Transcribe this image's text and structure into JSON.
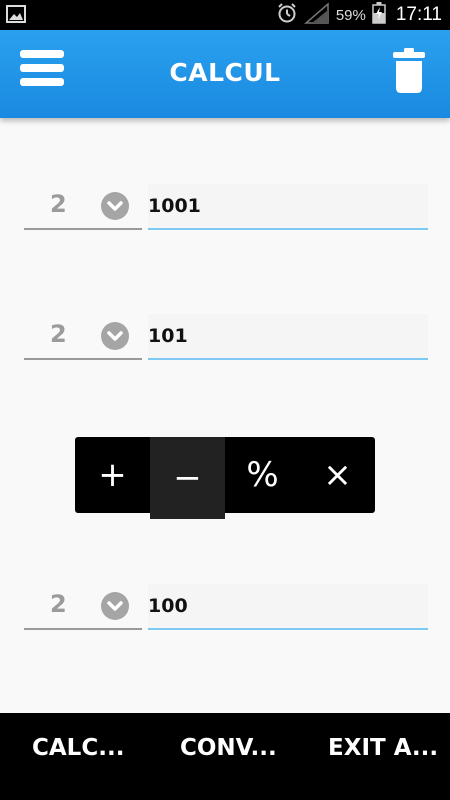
{
  "status_bar": {
    "battery_percent": "59%",
    "time": "17:11",
    "icons": [
      "image-icon",
      "alarm-icon",
      "signal-icon",
      "battery-charging-icon"
    ]
  },
  "app_bar": {
    "title": "CALCUL",
    "menu_icon": "hamburger-menu-icon",
    "delete_icon": "trash-icon"
  },
  "rows": [
    {
      "base": "2",
      "value": "1001"
    },
    {
      "base": "2",
      "value": "101"
    },
    {
      "base": "2",
      "value": "100"
    }
  ],
  "operators": {
    "items": [
      "+",
      "−",
      "%",
      "×"
    ],
    "selected": "−"
  },
  "bottom_nav": {
    "items": [
      "CALC...",
      "CONV...",
      "EXIT A..."
    ]
  },
  "colors": {
    "app_bar": "#1e92e6",
    "field_underline": "#7fc8f3",
    "background": "#f9f9f9",
    "bottom_bar": "#000000"
  }
}
